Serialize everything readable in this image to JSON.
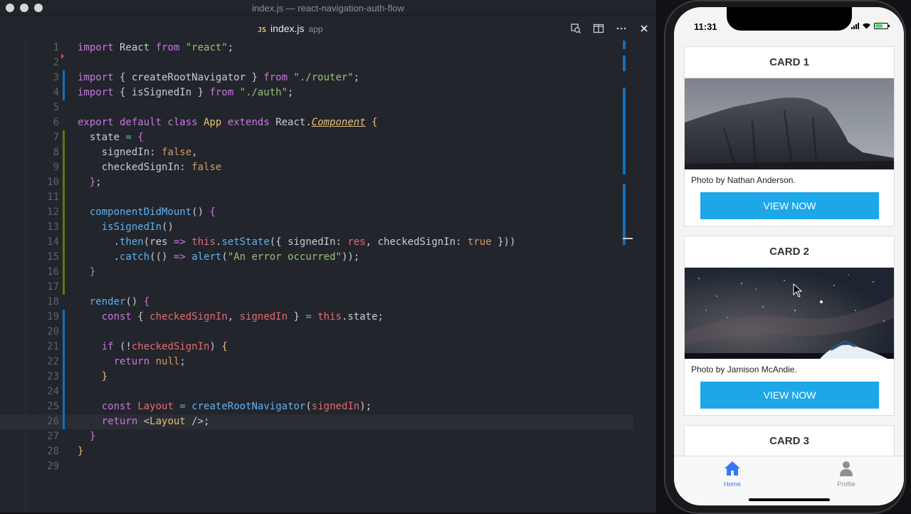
{
  "window": {
    "title": "index.js — react-navigation-auth-flow"
  },
  "tab": {
    "lang": "JS",
    "name": "index.js",
    "folder": "app"
  },
  "editor": {
    "lines": [
      {
        "n": "1",
        "html": "<span class='kw'>import</span> React <span class='kw'>from</span> <span class='str'>\"react\"</span>;"
      },
      {
        "n": "2",
        "html": ""
      },
      {
        "n": "3",
        "html": "<span class='kw'>import</span> { createRootNavigator } <span class='kw'>from</span> <span class='str'>\"./router\"</span>;"
      },
      {
        "n": "4",
        "html": "<span class='kw'>import</span> { isSignedIn } <span class='kw'>from</span> <span class='str'>\"./auth\"</span>;"
      },
      {
        "n": "5",
        "html": ""
      },
      {
        "n": "6",
        "html": "<span class='kw'>export default class</span> <span class='tag'>App</span> <span class='kw'>extends</span> React.<span class='cls'>Component</span> <span class='br1'>{</span>"
      },
      {
        "n": "7",
        "html": "  state <span class='op'>=</span> <span class='br2'>{</span>"
      },
      {
        "n": "8",
        "html": "    signedIn: <span class='num'>false</span>,"
      },
      {
        "n": "9",
        "html": "    checkedSignIn: <span class='num'>false</span>"
      },
      {
        "n": "10",
        "html": "  <span class='br2'>}</span>;"
      },
      {
        "n": "11",
        "html": ""
      },
      {
        "n": "12",
        "html": "  <span class='fn'>componentDidMount</span>() <span class='br2'>{</span>"
      },
      {
        "n": "13",
        "html": "    <span class='fn'>isSignedIn</span>()"
      },
      {
        "n": "14",
        "html": "      .<span class='fn'>then</span>(res <span class='kw'>=&gt;</span> <span class='var'>this</span>.<span class='fn'>setState</span>({ signedIn: <span class='var'>res</span>, checkedSignIn: <span class='num'>true</span> }))"
      },
      {
        "n": "15",
        "html": "      .<span class='fn'>catch</span>(() <span class='kw'>=&gt;</span> <span class='fn'>alert</span>(<span class='str'>\"An error occurred\"</span>));"
      },
      {
        "n": "16",
        "html": "  <span class='br2'>}</span>"
      },
      {
        "n": "17",
        "html": ""
      },
      {
        "n": "18",
        "html": "  <span class='fn'>render</span>() <span class='br2'>{</span>"
      },
      {
        "n": "19",
        "html": "    <span class='kw'>const</span> { <span class='var'>checkedSignIn</span>, <span class='var'>signedIn</span> } <span class='op'>=</span> <span class='var'>this</span>.state;"
      },
      {
        "n": "20",
        "html": ""
      },
      {
        "n": "21",
        "html": "    <span class='kw'>if</span> (!<span class='var'>checkedSignIn</span>) <span class='br1'>{</span>"
      },
      {
        "n": "22",
        "html": "      <span class='kw'>return</span> <span class='num'>null</span>;"
      },
      {
        "n": "23",
        "html": "    <span class='br1'>}</span>"
      },
      {
        "n": "24",
        "html": ""
      },
      {
        "n": "25",
        "html": "    <span class='kw'>const</span> <span class='var'>Layout</span> <span class='op'>=</span> <span class='fn'>createRootNavigator</span>(<span class='var'>signedIn</span>);"
      },
      {
        "n": "26",
        "html": "    <span class='kw'>return</span> &lt;<span class='tag'>Layout</span> /&gt;;"
      },
      {
        "n": "27",
        "html": "  <span class='br2'>}</span>"
      },
      {
        "n": "28",
        "html": "<span class='br1'>}</span>"
      },
      {
        "n": "29",
        "html": ""
      }
    ]
  },
  "phone": {
    "time": "11:31",
    "cards": [
      {
        "title": "CARD 1",
        "caption": "Photo by Nathan Anderson.",
        "button": "VIEW NOW"
      },
      {
        "title": "CARD 2",
        "caption": "Photo by Jamison McAndie.",
        "button": "VIEW NOW"
      },
      {
        "title": "CARD 3",
        "caption": "",
        "button": ""
      }
    ],
    "tabs": [
      {
        "label": "Home",
        "active": true
      },
      {
        "label": "Profile",
        "active": false
      }
    ],
    "colors": {
      "accent": "#1ea7e8",
      "tab_active": "#3478f6",
      "tab_inactive": "#8e8e93"
    }
  }
}
